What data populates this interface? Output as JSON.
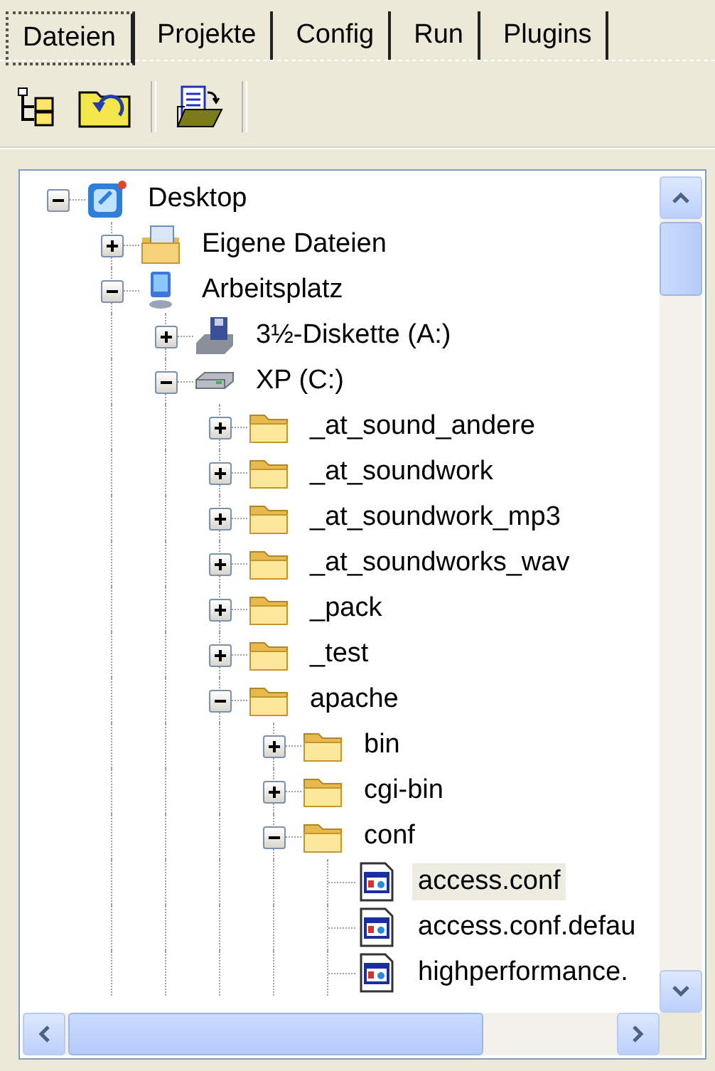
{
  "tabs": [
    {
      "label": "Dateien",
      "selected": true
    },
    {
      "label": "Projekte",
      "selected": false
    },
    {
      "label": "Config",
      "selected": false
    },
    {
      "label": "Run",
      "selected": false
    },
    {
      "label": "Plugins",
      "selected": false
    }
  ],
  "toolbar": [
    {
      "kind": "tree"
    },
    {
      "kind": "folder-back"
    },
    {
      "kind": "separator"
    },
    {
      "kind": "open-document"
    },
    {
      "kind": "separator"
    }
  ],
  "tree": [
    {
      "label": "Desktop",
      "kind": "desktop",
      "expanded": true,
      "selected": false,
      "children": [
        {
          "label": "Eigene Dateien",
          "kind": "documents",
          "expanded": false,
          "selected": false
        },
        {
          "label": "Arbeitsplatz",
          "kind": "computer",
          "expanded": true,
          "selected": false,
          "children": [
            {
              "label": "3½-Diskette (A:)",
              "kind": "floppy",
              "expanded": false,
              "selected": false
            },
            {
              "label": "XP (C:)",
              "kind": "drive",
              "expanded": true,
              "selected": false,
              "children": [
                {
                  "label": "_at_sound_andere",
                  "kind": "folder",
                  "expanded": false,
                  "selected": false
                },
                {
                  "label": "_at_soundwork",
                  "kind": "folder",
                  "expanded": false,
                  "selected": false
                },
                {
                  "label": "_at_soundwork_mp3",
                  "kind": "folder",
                  "expanded": false,
                  "selected": false
                },
                {
                  "label": "_at_soundworks_wav",
                  "kind": "folder",
                  "expanded": false,
                  "selected": false
                },
                {
                  "label": "_pack",
                  "kind": "folder",
                  "expanded": false,
                  "selected": false
                },
                {
                  "label": "_test",
                  "kind": "folder",
                  "expanded": false,
                  "selected": false
                },
                {
                  "label": "apache",
                  "kind": "folder",
                  "expanded": true,
                  "selected": false,
                  "children": [
                    {
                      "label": "bin",
                      "kind": "folder",
                      "expanded": false,
                      "selected": false
                    },
                    {
                      "label": "cgi-bin",
                      "kind": "folder",
                      "expanded": false,
                      "selected": false
                    },
                    {
                      "label": "conf",
                      "kind": "folder",
                      "expanded": true,
                      "selected": false,
                      "children": [
                        {
                          "label": "access.conf",
                          "kind": "file",
                          "selected": true
                        },
                        {
                          "label": "access.conf.defau",
                          "kind": "file",
                          "selected": false
                        },
                        {
                          "label": "highperformance.",
                          "kind": "file",
                          "selected": false
                        }
                      ]
                    }
                  ]
                }
              ]
            }
          ]
        }
      ]
    }
  ]
}
